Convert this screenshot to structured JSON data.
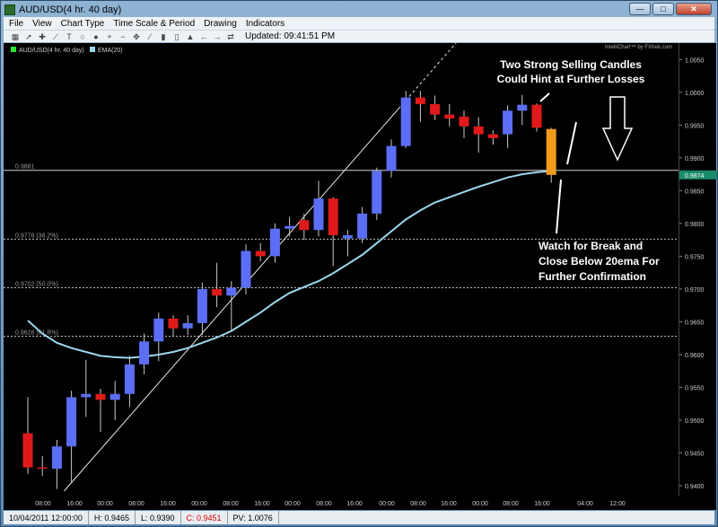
{
  "window": {
    "title": "AUD/USD(4 hr.  40 day)"
  },
  "menu": [
    "File",
    "View",
    "Chart Type",
    "Time Scale & Period",
    "Drawing",
    "Indicators"
  ],
  "toolbar": {
    "icons": [
      "grid-icon",
      "cursor-icon",
      "crosshair-icon",
      "trendline-icon",
      "text-icon",
      "circle-icon",
      "marker-icon",
      "zoom-in-icon",
      "zoom-out-icon",
      "pan-icon",
      "line-chart-icon",
      "bar-chart-icon",
      "candle-icon",
      "area-icon",
      "arrow-left-icon",
      "arrow-right-icon",
      "scroll-icon"
    ],
    "updated": "Updated: 09:41:51 PM"
  },
  "chart_header": {
    "symbol_label": "AUD/USD(4 hr.  40 day)",
    "indicator_label": "EMA(20)"
  },
  "watermark": "IntelliChart™ by FXtrek.com",
  "annotations": {
    "top": [
      "Two Strong Selling Candles",
      "Could Hint at Further Losses"
    ],
    "bottom": [
      "Watch for Break and",
      "Close Below 20ema For",
      "Further Confirmation"
    ]
  },
  "levels": [
    {
      "label": "0.9881",
      "value": 0.9881
    },
    {
      "label": "0.9776 (38.2%)",
      "value": 0.9776
    },
    {
      "label": "0.9702 (50.0%)",
      "value": 0.9702
    },
    {
      "label": "0.9628 (61.8%)",
      "value": 0.9628
    }
  ],
  "current_price": "0.9874",
  "colors": {
    "up": "#5b6ef5",
    "down": "#e01a1a",
    "highlight": "#f39a1a",
    "ema": "#9ad7ee",
    "background": "#000000"
  },
  "chart_data": {
    "type": "candlestick",
    "ylim": [
      0.9385,
      1.0075
    ],
    "yticks": [
      "1.0050",
      "1.0000",
      "0.9950",
      "0.9900",
      "0.9850",
      "0.9800",
      "0.9750",
      "0.9700",
      "0.9650",
      "0.9600",
      "0.9550",
      "0.9500",
      "0.9450",
      "0.9400"
    ],
    "xticks": [
      "08:00",
      "16:00",
      "00:00",
      "08:00",
      "16:00",
      "00:00",
      "08:00",
      "16:00",
      "00:00",
      "08:00",
      "16:00",
      "00:00",
      "08:00",
      "16:00",
      "00:00",
      "08:00",
      "16:00",
      "04:00",
      "12:00"
    ],
    "candles": [
      {
        "o": 0.948,
        "h": 0.9535,
        "l": 0.9418,
        "c": 0.9428,
        "dir": "down"
      },
      {
        "o": 0.9428,
        "h": 0.9445,
        "l": 0.9415,
        "c": 0.9426,
        "dir": "down"
      },
      {
        "o": 0.9426,
        "h": 0.947,
        "l": 0.9395,
        "c": 0.946,
        "dir": "up"
      },
      {
        "o": 0.946,
        "h": 0.9545,
        "l": 0.9405,
        "c": 0.9535,
        "dir": "up"
      },
      {
        "o": 0.9535,
        "h": 0.9592,
        "l": 0.9505,
        "c": 0.954,
        "dir": "up"
      },
      {
        "o": 0.954,
        "h": 0.9548,
        "l": 0.9482,
        "c": 0.9531,
        "dir": "down"
      },
      {
        "o": 0.9531,
        "h": 0.956,
        "l": 0.95,
        "c": 0.954,
        "dir": "up"
      },
      {
        "o": 0.954,
        "h": 0.9598,
        "l": 0.952,
        "c": 0.9585,
        "dir": "up"
      },
      {
        "o": 0.9585,
        "h": 0.9632,
        "l": 0.957,
        "c": 0.962,
        "dir": "up"
      },
      {
        "o": 0.962,
        "h": 0.9664,
        "l": 0.959,
        "c": 0.9655,
        "dir": "up"
      },
      {
        "o": 0.9655,
        "h": 0.966,
        "l": 0.9628,
        "c": 0.964,
        "dir": "down"
      },
      {
        "o": 0.964,
        "h": 0.966,
        "l": 0.963,
        "c": 0.9648,
        "dir": "up"
      },
      {
        "o": 0.9648,
        "h": 0.971,
        "l": 0.963,
        "c": 0.97,
        "dir": "up"
      },
      {
        "o": 0.97,
        "h": 0.974,
        "l": 0.9672,
        "c": 0.969,
        "dir": "down"
      },
      {
        "o": 0.969,
        "h": 0.9712,
        "l": 0.9636,
        "c": 0.9702,
        "dir": "up"
      },
      {
        "o": 0.9702,
        "h": 0.9768,
        "l": 0.9692,
        "c": 0.9758,
        "dir": "up"
      },
      {
        "o": 0.9758,
        "h": 0.977,
        "l": 0.9742,
        "c": 0.975,
        "dir": "down"
      },
      {
        "o": 0.975,
        "h": 0.98,
        "l": 0.974,
        "c": 0.9792,
        "dir": "up"
      },
      {
        "o": 0.9792,
        "h": 0.981,
        "l": 0.978,
        "c": 0.9796,
        "dir": "up"
      },
      {
        "o": 0.9805,
        "h": 0.9815,
        "l": 0.9775,
        "c": 0.979,
        "dir": "down"
      },
      {
        "o": 0.979,
        "h": 0.9865,
        "l": 0.978,
        "c": 0.9838,
        "dir": "up"
      },
      {
        "o": 0.9838,
        "h": 0.984,
        "l": 0.9735,
        "c": 0.9782,
        "dir": "down"
      },
      {
        "o": 0.9782,
        "h": 0.979,
        "l": 0.975,
        "c": 0.9777,
        "dir": "up"
      },
      {
        "o": 0.9777,
        "h": 0.9825,
        "l": 0.977,
        "c": 0.9815,
        "dir": "up"
      },
      {
        "o": 0.9815,
        "h": 0.9885,
        "l": 0.9805,
        "c": 0.988,
        "dir": "up"
      },
      {
        "o": 0.988,
        "h": 0.9928,
        "l": 0.987,
        "c": 0.9918,
        "dir": "up"
      },
      {
        "o": 0.9918,
        "h": 1.0002,
        "l": 0.9915,
        "c": 0.9992,
        "dir": "up"
      },
      {
        "o": 0.9992,
        "h": 1.0002,
        "l": 0.9955,
        "c": 0.9982,
        "dir": "down"
      },
      {
        "o": 0.9982,
        "h": 0.9995,
        "l": 0.9958,
        "c": 0.9966,
        "dir": "down"
      },
      {
        "o": 0.9966,
        "h": 0.9982,
        "l": 0.9948,
        "c": 0.996,
        "dir": "down"
      },
      {
        "o": 0.9963,
        "h": 0.9972,
        "l": 0.993,
        "c": 0.9948,
        "dir": "down"
      },
      {
        "o": 0.9948,
        "h": 0.9962,
        "l": 0.9908,
        "c": 0.9936,
        "dir": "down"
      },
      {
        "o": 0.993,
        "h": 0.9942,
        "l": 0.992,
        "c": 0.9936,
        "dir": "down"
      },
      {
        "o": 0.9936,
        "h": 0.998,
        "l": 0.9915,
        "c": 0.9972,
        "dir": "up"
      },
      {
        "o": 0.9972,
        "h": 0.9996,
        "l": 0.995,
        "c": 0.9981,
        "dir": "up"
      },
      {
        "o": 0.9981,
        "h": 0.9983,
        "l": 0.994,
        "c": 0.9946,
        "dir": "down"
      },
      {
        "o": 0.9944,
        "h": 0.9946,
        "l": 0.9862,
        "c": 0.9874,
        "dir": "highlight"
      }
    ],
    "ema": [
      0.9652,
      0.9632,
      0.9618,
      0.961,
      0.9604,
      0.9598,
      0.9596,
      0.9595,
      0.9597,
      0.96,
      0.9604,
      0.961,
      0.9618,
      0.9626,
      0.9636,
      0.965,
      0.9664,
      0.968,
      0.9694,
      0.9703,
      0.9712,
      0.9724,
      0.9738,
      0.9752,
      0.977,
      0.9788,
      0.9806,
      0.982,
      0.9832,
      0.984,
      0.9848,
      0.9856,
      0.9863,
      0.987,
      0.9875,
      0.9878,
      0.988
    ]
  },
  "status": {
    "datetime": "10/04/2011 12:00:00",
    "high": "H: 0.9465",
    "low": "L: 0.9390",
    "close": "C: 0.9451",
    "pv": "PV: 1.0076"
  }
}
